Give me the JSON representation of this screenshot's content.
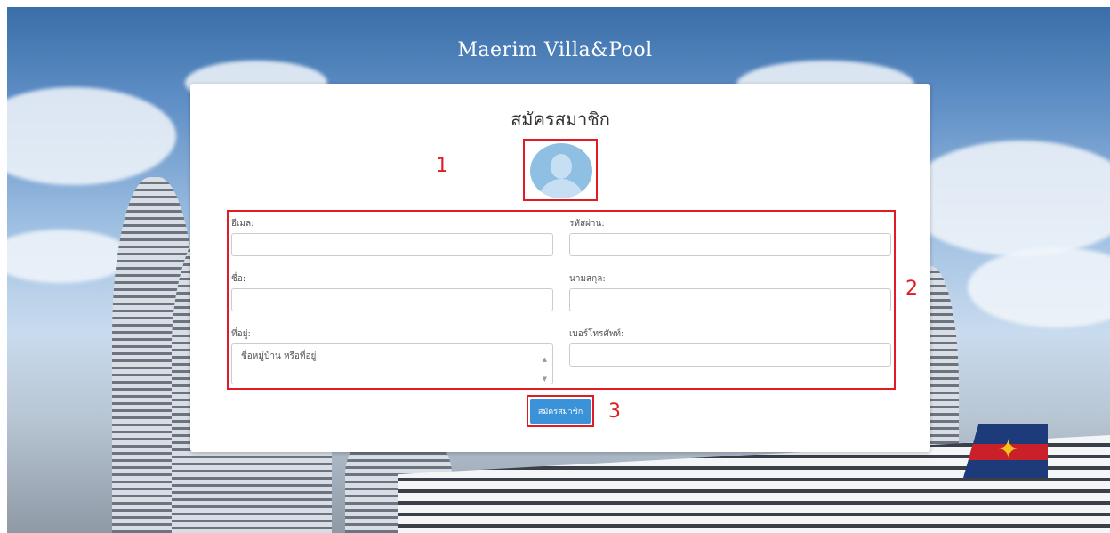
{
  "site_title": "Maerim  Villa&Pool",
  "form": {
    "title": "สมัครสมาชิก",
    "email_label": "อีเมล:",
    "password_label": "รหัสผ่าน:",
    "firstname_label": "ชื่อ:",
    "lastname_label": "นามสกุล:",
    "address_label": "ที่อยู่:",
    "address_placeholder": "ชื่อหมู่บ้าน หรือที่อยู่",
    "phone_label": "เบอร์โทรศัพท์:",
    "submit_label": "สมัครสมาชิก"
  },
  "annotations": [
    "1",
    "2",
    "3"
  ],
  "colors": {
    "annotation": "#e01b24",
    "button": "#3a92d8"
  },
  "icons": {
    "avatar": "user-silhouette-icon"
  }
}
